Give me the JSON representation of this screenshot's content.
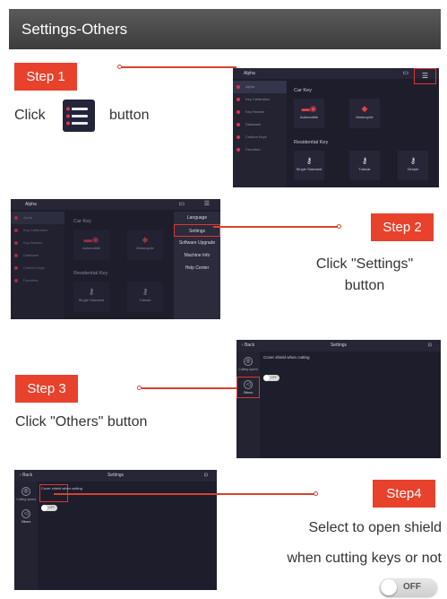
{
  "banner": {
    "title": "Settings-Others"
  },
  "step1": {
    "badge": "Step 1",
    "click_word": "Click",
    "button_word": "button",
    "screen": {
      "app_title": "Alpha",
      "sidebar": [
        "Alpha",
        "Key Calibration",
        "Key Reader",
        "Database",
        "Custom Keys",
        "Favorites"
      ],
      "sections": [
        {
          "title": "Car Key",
          "tiles": [
            {
              "label": "Automobile",
              "icon": "car-key-icon"
            },
            {
              "label": "Motorcycle",
              "icon": "motorcycle-icon"
            }
          ]
        },
        {
          "title": "Residential Key",
          "tiles": [
            {
              "label": "Single Standard",
              "icon": "key-icon"
            },
            {
              "label": "Tubular",
              "icon": "tubular-key-icon"
            },
            {
              "label": "Dimple",
              "icon": "dimple-key-icon"
            }
          ]
        }
      ]
    }
  },
  "step2": {
    "badge": "Step 2",
    "instruction_line1": "Click \"Settings\"",
    "instruction_line2": "button",
    "screen": {
      "app_title": "Alpha",
      "sidebar": [
        "Alpha",
        "Key Calibration",
        "Key Reader",
        "Database",
        "Custom Keys",
        "Favorites"
      ],
      "section1": "Car Key",
      "section2": "Residential Key",
      "tiles": [
        "Automobile",
        "Motorcycle",
        "Single Standard",
        "Tubular"
      ],
      "menu": [
        "Language",
        "Settings",
        "Software Upgrade",
        "Machine Info",
        "Help Center"
      ]
    }
  },
  "step3": {
    "badge": "Step 3",
    "instruction": "Click \"Others\" button",
    "screen": {
      "back": "Back",
      "title": "Settings",
      "option": "Cover shield when cutting",
      "toggle_text": "OFF",
      "side": [
        {
          "label": "Cutting speed",
          "icon": "speed-icon"
        },
        {
          "label": "Others",
          "icon": "others-icon"
        }
      ]
    }
  },
  "step4": {
    "badge": "Step4",
    "instruction_line1": "Select to open shield",
    "instruction_line2": "when cutting keys or not",
    "toggle_text": "OFF",
    "screen": {
      "back": "Back",
      "title": "Settings",
      "option": "Cover shield when cutting",
      "toggle_text": "OFF",
      "side": [
        {
          "label": "Cutting speed",
          "icon": "speed-icon"
        },
        {
          "label": "Others",
          "icon": "others-icon"
        }
      ]
    }
  },
  "colors": {
    "accent": "#e8412c",
    "screen_bg": "#1d1d2b",
    "banner": "#4a4a4a"
  }
}
